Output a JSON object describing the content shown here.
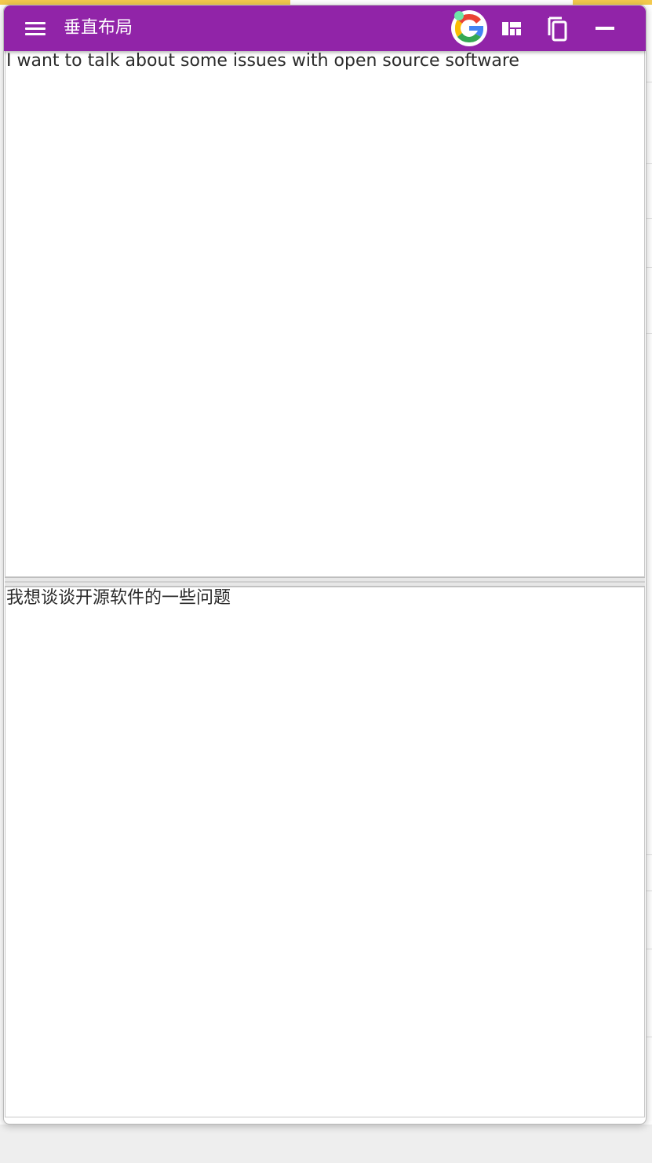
{
  "window": {
    "title": "垂直布局"
  },
  "panes": {
    "source_text": "I want to talk about some issues with open source software",
    "translated_text": "我想谈谈开源软件的一些问题"
  },
  "icons": {
    "menu": "hamburger-menu-icon",
    "translator": "google-icon",
    "layout": "layout-grid-icon",
    "copy": "copy-icon",
    "minimize": "minimize-icon"
  },
  "colors": {
    "titlebar": "#9124a8",
    "background_strip": "#f3c94d"
  }
}
